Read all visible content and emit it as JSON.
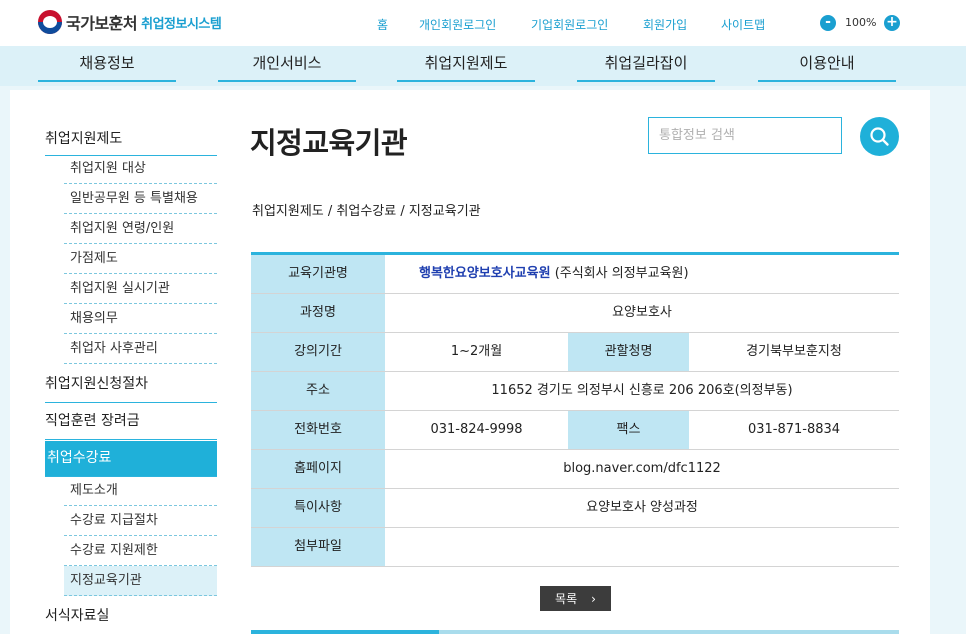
{
  "header": {
    "logo_org": "국가보훈처",
    "logo_system": "취업정보시스템",
    "util_links": [
      "홈",
      "개인회원로그인",
      "기업회원로그인",
      "회원가입",
      "사이트맵"
    ],
    "zoom_minus": "-",
    "zoom_value": "100%",
    "zoom_plus": "+"
  },
  "gnb": [
    "채용정보",
    "개인서비스",
    "취업지원제도",
    "취업길라잡이",
    "이용안내"
  ],
  "sidebar": {
    "title": "취업지원제도",
    "group1": [
      "취업지원 대상",
      "일반공무원 등 특별채용",
      "취업지원 연령/인원",
      "가점제도",
      "취업지원 실시기관",
      "채용의무",
      "취업자 사후관리"
    ],
    "main2": "취업지원신청절차",
    "main3": "직업훈련 장려금",
    "main4": "취업수강료",
    "group4": [
      "제도소개",
      "수강료 지급절차",
      "수강료 지원제한",
      "지정교육기관"
    ],
    "main5": "서식자료실"
  },
  "page": {
    "title": "지정교육기관",
    "search_placeholder": "통합정보 검색",
    "breadcrumb": "취업지원제도 / 취업수강료 / 지정교육기관"
  },
  "detail": {
    "inst_label": "교육기관명",
    "inst_name": "행복한요양보호사교육원",
    "inst_corp": " (주식회사 의정부교육원)",
    "course_label": "과정명",
    "course": "요양보호사",
    "period_label": "강의기간",
    "period": "1~2개월",
    "office_label": "관할청명",
    "office": "경기북부보훈지청",
    "address_label": "주소",
    "address": "11652 경기도 의정부시 신흥로 206 206호(의정부동)",
    "phone_label": "전화번호",
    "phone": "031-824-9998",
    "fax_label": "팩스",
    "fax": "031-871-8834",
    "homepage_label": "홈페이지",
    "homepage": "blog.naver.com/dfc1122",
    "notes_label": "특이사항",
    "notes": "요양보호사 양성과정",
    "attach_label": "첨부파일",
    "attach": ""
  },
  "list_button": "목록",
  "colors": {
    "accent": "#1fb0d9",
    "th_bg": "#bfe6f3",
    "gnb_bg": "#dcf1f8"
  }
}
